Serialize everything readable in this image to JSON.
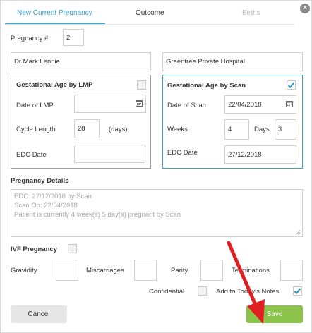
{
  "tabs": [
    {
      "label": "New Current Pregnancy",
      "state": "active"
    },
    {
      "label": "Outcome",
      "state": "normal"
    },
    {
      "label": "Births",
      "state": "disabled"
    }
  ],
  "close_glyph": "×",
  "pregnancy_number": {
    "label": "Pregnancy #",
    "value": "2"
  },
  "doctor": "Dr Mark Lennie",
  "hospital": "Greentree Private Hospital",
  "lmp_panel": {
    "title": "Gestational Age by LMP",
    "checked": false,
    "date_label": "Date of LMP",
    "date_value": "",
    "cycle_label": "Cycle Length",
    "cycle_value": "28",
    "cycle_unit": "(days)",
    "edc_label": "EDC Date",
    "edc_value": ""
  },
  "scan_panel": {
    "title": "Gestational Age by Scan",
    "checked": true,
    "date_label": "Date of Scan",
    "date_value": "22/04/2018",
    "weeks_label": "Weeks",
    "weeks_value": "4",
    "days_label": "Days",
    "days_value": "3",
    "edc_label": "EDC Date",
    "edc_value": "27/12/2018"
  },
  "details": {
    "title": "Pregnancy Details",
    "lines": [
      "EDC: 27/12/2018 by Scan",
      "Scan On: 22/04/2018",
      "Patient is currently 4 week(s) 5 day(s) pregnant by Scan"
    ]
  },
  "ivf": {
    "label": "IVF Pregnancy",
    "checked": false
  },
  "counts": {
    "gravidity_label": "Gravidity",
    "gravidity_value": "",
    "miscarriages_label": "Miscarriages",
    "miscarriages_value": "",
    "parity_label": "Parity",
    "parity_value": "",
    "terminations_label": "Terminations",
    "terminations_value": ""
  },
  "confidential": {
    "label": "Confidential",
    "checked": false
  },
  "add_to_todays_notes": {
    "label": "Add to Today's Notes",
    "checked": true
  },
  "buttons": {
    "cancel": "Cancel",
    "save": "Save"
  },
  "colors": {
    "accent": "#3aa3c6",
    "save": "#8bc34a",
    "arrow": "#e02020"
  }
}
